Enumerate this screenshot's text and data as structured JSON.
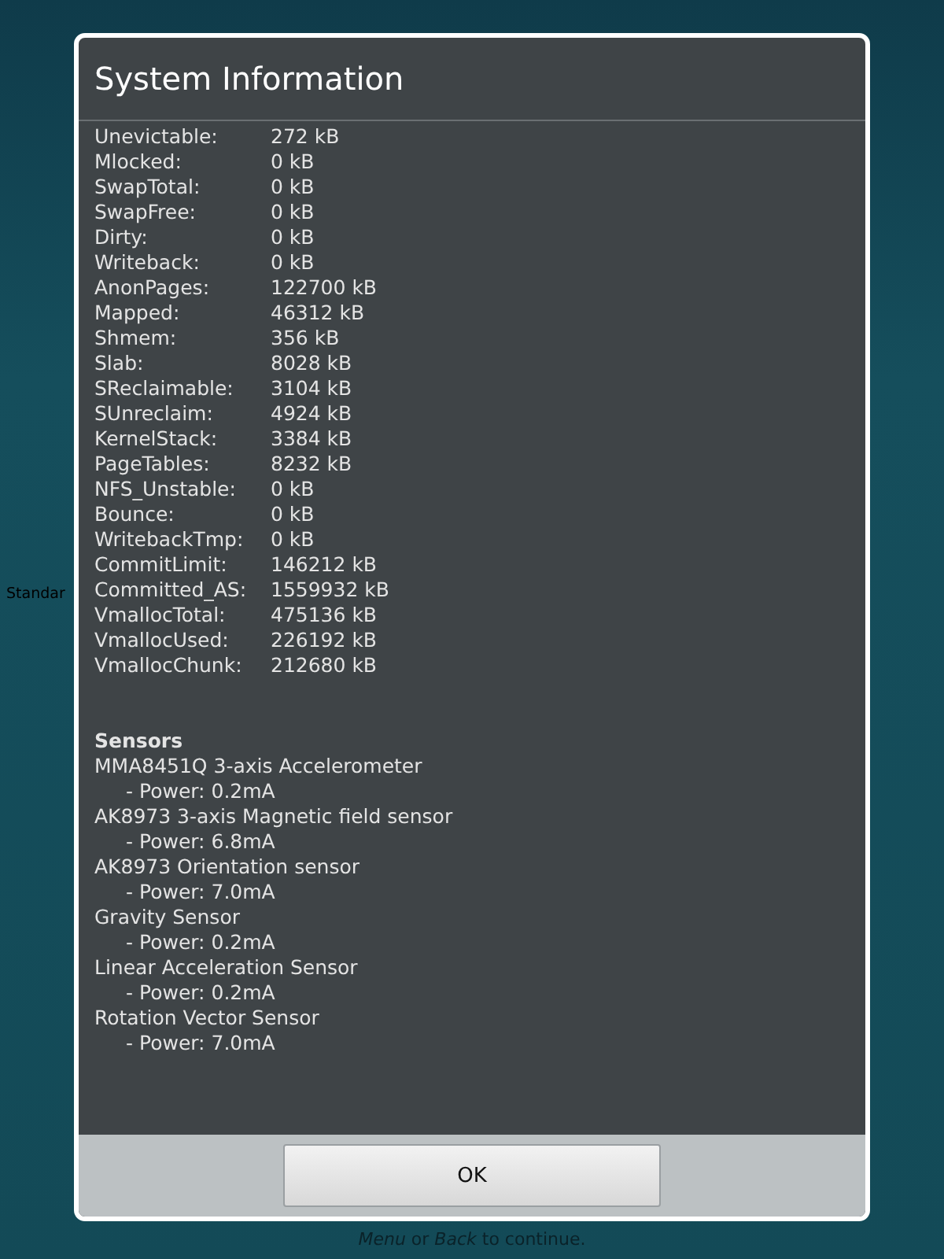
{
  "background": {
    "label": "Standar",
    "hint": "*Menu* or *Back* to continue."
  },
  "dialog": {
    "title": "System Information",
    "memory": [
      {
        "label": "Unevictable:",
        "value": "272 kB"
      },
      {
        "label": "Mlocked:",
        "value": "0 kB"
      },
      {
        "label": "SwapTotal:",
        "value": "0 kB"
      },
      {
        "label": "SwapFree:",
        "value": "0 kB"
      },
      {
        "label": "Dirty:",
        "value": "0 kB"
      },
      {
        "label": "Writeback:",
        "value": "0 kB"
      },
      {
        "label": "AnonPages:",
        "value": "122700 kB"
      },
      {
        "label": "Mapped:",
        "value": "46312 kB"
      },
      {
        "label": "Shmem:",
        "value": "356 kB"
      },
      {
        "label": "Slab:",
        "value": "8028 kB"
      },
      {
        "label": "SReclaimable:",
        "value": "3104 kB"
      },
      {
        "label": "SUnreclaim:",
        "value": "4924 kB"
      },
      {
        "label": "KernelStack:",
        "value": "3384 kB"
      },
      {
        "label": "PageTables:",
        "value": "8232 kB"
      },
      {
        "label": "NFS_Unstable:",
        "value": "0 kB"
      },
      {
        "label": "Bounce:",
        "value": "0 kB"
      },
      {
        "label": "WritebackTmp:",
        "value": "0 kB"
      },
      {
        "label": "CommitLimit:",
        "value": "146212 kB"
      },
      {
        "label": "Committed_AS:",
        "value": "1559932 kB"
      },
      {
        "label": "VmallocTotal:",
        "value": "475136 kB"
      },
      {
        "label": "VmallocUsed:",
        "value": "226192 kB"
      },
      {
        "label": "VmallocChunk:",
        "value": "212680 kB"
      }
    ],
    "sensors_heading": "Sensors",
    "sensors": [
      {
        "name": "MMA8451Q 3-axis Accelerometer",
        "power": "- Power: 0.2mA"
      },
      {
        "name": "AK8973 3-axis Magnetic field sensor",
        "power": "- Power: 6.8mA"
      },
      {
        "name": "AK8973 Orientation sensor",
        "power": "- Power: 7.0mA"
      },
      {
        "name": "Gravity Sensor",
        "power": "- Power: 0.2mA"
      },
      {
        "name": "Linear Acceleration Sensor",
        "power": "- Power: 0.2mA"
      },
      {
        "name": "Rotation Vector Sensor",
        "power": "- Power: 7.0mA"
      }
    ],
    "button": "OK"
  }
}
